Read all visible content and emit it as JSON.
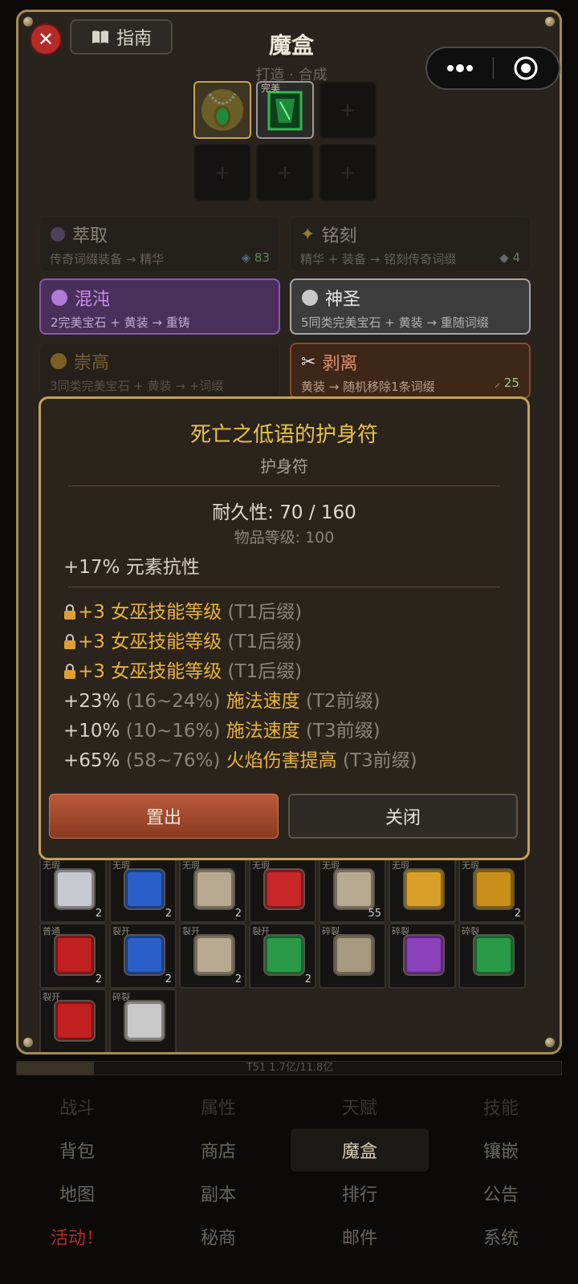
{
  "header": {
    "title": "魔盒",
    "subtitle": "打造 · 合成",
    "guide_label": "指南",
    "close_glyph": "✕",
    "guide_icon": "book-icon"
  },
  "slots": {
    "slot2_tag": "完美",
    "empty_glyph": "+"
  },
  "cards": [
    {
      "id": "extract",
      "title": "萃取",
      "desc": "传奇词缀装备 → 精华",
      "count": "83",
      "color": "#6b5a8a"
    },
    {
      "id": "engrave",
      "title": "铭刻",
      "desc": "精华 + 装备 → 铭刻传奇词缀",
      "count": "4",
      "color": "#d8b84a"
    },
    {
      "id": "chaos",
      "title": "混沌",
      "desc": "2完美宝石 + 黄装 → 重铸",
      "count": "",
      "color": "#a46ad0"
    },
    {
      "id": "holy",
      "title": "神圣",
      "desc": "5同类完美宝石 + 黄装 → 重随词缀",
      "count": "",
      "color": "#c8c8c8"
    },
    {
      "id": "exalt",
      "title": "崇高",
      "desc": "3同类完美宝石 + 黄装 → +词缀",
      "count": "",
      "color": "#b8862a"
    },
    {
      "id": "strip",
      "title": "剥离",
      "desc": "黄装 → 随机移除1条词缀",
      "count": "25",
      "color": "#d07a50"
    }
  ],
  "modal": {
    "item_name": "死亡之低语的护身符",
    "item_type": "护身符",
    "durability": "耐久性: 70 / 160",
    "item_level": "物品等级: 100",
    "implicit": "+17% 元素抗性",
    "affixes": [
      {
        "locked": true,
        "value": "+3",
        "range": "",
        "name": "女巫技能等级",
        "tier": "(T1后缀)"
      },
      {
        "locked": true,
        "value": "+3",
        "range": "",
        "name": "女巫技能等级",
        "tier": "(T1后缀)"
      },
      {
        "locked": true,
        "value": "+3",
        "range": "",
        "name": "女巫技能等级",
        "tier": "(T1后缀)"
      },
      {
        "locked": false,
        "value": "+23%",
        "range": "(16~24%)",
        "name": "施法速度",
        "tier": "(T2前缀)"
      },
      {
        "locked": false,
        "value": "+10%",
        "range": "(10~16%)",
        "name": "施法速度",
        "tier": "(T3前缀)"
      },
      {
        "locked": false,
        "value": "+65%",
        "range": "(58~76%)",
        "name": "火焰伤害提高",
        "tier": "(T3前缀)"
      }
    ],
    "place_label": "置出",
    "close_label": "关闭"
  },
  "inventory": [
    {
      "tag": "无瑕",
      "count": "2",
      "color": "#c8c8d0",
      "icon": "diamond-gem-icon"
    },
    {
      "tag": "无瑕",
      "count": "2",
      "color": "#2a5fc8",
      "icon": "sapphire-gem-icon"
    },
    {
      "tag": "无瑕",
      "count": "2",
      "color": "#b8aa90",
      "icon": "skull-gem-icon"
    },
    {
      "tag": "无瑕",
      "count": "",
      "color": "#c82828",
      "icon": "ruby-gem-icon"
    },
    {
      "tag": "无瑕",
      "count": "55",
      "color": "#b8aa90",
      "icon": "skull-gem-icon"
    },
    {
      "tag": "无瑕",
      "count": "",
      "color": "#d8a028",
      "icon": "topaz-gem-icon"
    },
    {
      "tag": "无瑕",
      "count": "2",
      "color": "#c8901a",
      "icon": "amber-gem-icon"
    },
    {
      "tag": "普通",
      "count": "2",
      "color": "#c02020",
      "icon": "ruby-gem-icon"
    },
    {
      "tag": "裂开",
      "count": "2",
      "color": "#2a5fc8",
      "icon": "sapphire-gem-icon"
    },
    {
      "tag": "裂开",
      "count": "2",
      "color": "#b8aa90",
      "icon": "skull-gem-icon"
    },
    {
      "tag": "裂开",
      "count": "2",
      "color": "#2a9a48",
      "icon": "emerald-gem-icon"
    },
    {
      "tag": "碎裂",
      "count": "",
      "color": "#a89a80",
      "icon": "skull-gem-icon"
    },
    {
      "tag": "碎裂",
      "count": "",
      "color": "#8a40b8",
      "icon": "amethyst-gem-icon"
    },
    {
      "tag": "碎裂",
      "count": "",
      "color": "#2a9a48",
      "icon": "emerald-gem-icon"
    },
    {
      "tag": "裂开",
      "count": "",
      "color": "#c02020",
      "icon": "ruby-gem-icon"
    },
    {
      "tag": "碎裂",
      "count": "",
      "color": "#c8c8c8",
      "icon": "diamond-gem-icon"
    }
  ],
  "exp_bar": {
    "text": "T51  1.7亿/11.8亿"
  },
  "nav": [
    [
      "战斗",
      "属性",
      "天赋",
      "技能"
    ],
    [
      "背包",
      "商店",
      "魔盒",
      "镶嵌"
    ],
    [
      "地图",
      "副本",
      "排行",
      "公告"
    ],
    [
      "活动！",
      "秘商",
      "邮件",
      "系统"
    ]
  ]
}
